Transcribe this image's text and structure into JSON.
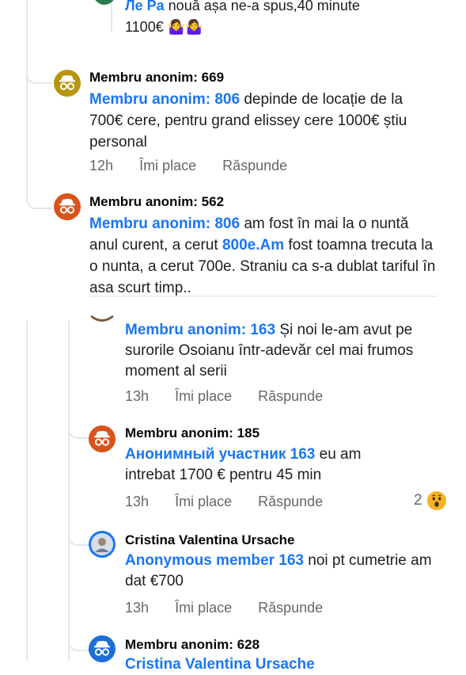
{
  "comments": [
    {
      "id": "c0",
      "mention": "Ле Pa",
      "text": " nouă așa ne-a spus,40 minute",
      "text2": "1100€",
      "emoji": "🤷‍♀️🤷‍♀️"
    },
    {
      "id": "c1",
      "author": "Membru anonim: 669",
      "mention": "Membru anonim: 806",
      "text": " depinde de locație de la 700€ cere, pentru grand elissey cere 1000€ știu personal",
      "time": "12h",
      "like": "Îmi place",
      "reply": "Răspunde",
      "avatar_color": "#b8960c"
    },
    {
      "id": "c2",
      "author": "Membru anonim: 562",
      "mention": "Membru anonim: 806",
      "text_a": " am fost în mai la o nuntă anul curent, a cerut ",
      "mention2": "800e.Am",
      "text_b": " fost toamna trecuta la o nunta, a cerut 700e. Straniu ca s-a dublat tariful în asa scurt timp..",
      "avatar_color": "#d9541a"
    },
    {
      "id": "c3",
      "mention": "Membru anonim: 163",
      "text": " Și noi le-am avut pe surorile Osoianu într-adevăr cel mai frumos moment al serii",
      "time": "13h",
      "like": "Îmi place",
      "reply": "Răspunde"
    },
    {
      "id": "c4",
      "author": "Membru anonim: 185",
      "mention": "Анонимный участник 163",
      "text": " eu am intrebat 1700 € pentru 45 min",
      "time": "13h",
      "like": "Îmi place",
      "reply": "Răspunde",
      "reaction_count": "2",
      "reaction_icon": "wow-icon",
      "avatar_color": "#d9541a"
    },
    {
      "id": "c5",
      "author": "Cristina Valentina Ursache",
      "mention": "Anonymous member 163",
      "text": " noi pt cumetrie am dat €700",
      "time": "13h",
      "like": "Îmi place",
      "reply": "Răspunde"
    },
    {
      "id": "c6",
      "author": "Membru anonim: 628",
      "mention": "Cristina Valentina Ursache",
      "avatar_color": "#1d6fd6"
    }
  ],
  "colors": {
    "mention": "#1877f2",
    "meta": "#65676b",
    "thread_line": "#e4e6eb"
  }
}
